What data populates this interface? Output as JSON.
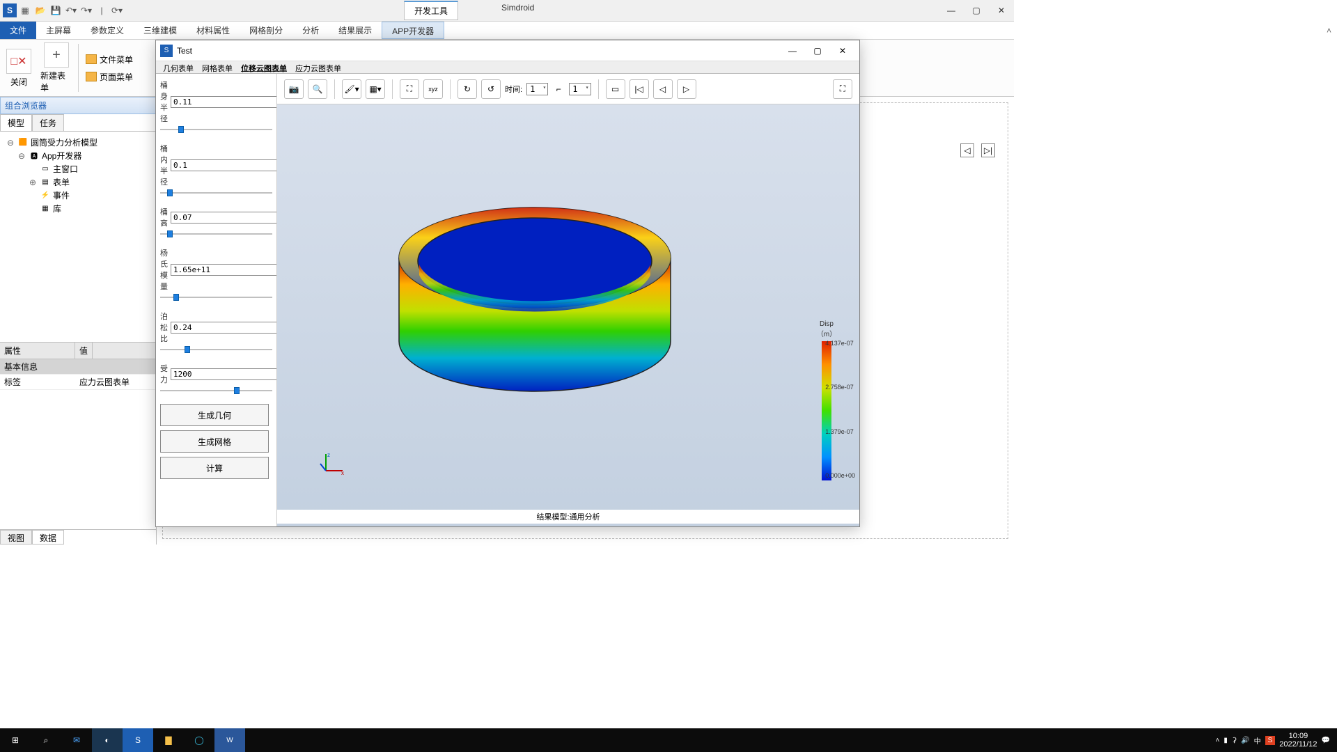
{
  "titlebar": {
    "devtools_tab": "开发工具",
    "app_title": "Simdroid"
  },
  "menu": {
    "items": [
      "文件",
      "主屏幕",
      "参数定义",
      "三维建模",
      "材料属性",
      "网格剖分",
      "分析",
      "结果展示",
      "APP开发器"
    ],
    "active": 0,
    "highlighted": 8
  },
  "ribbon": {
    "close": "关闭",
    "new_form": "新建表单",
    "file_menu": "文件菜单",
    "page_menu": "页面菜单"
  },
  "browser": {
    "title": "组合浏览器",
    "tabs": {
      "model": "模型",
      "task": "任务"
    },
    "tree": [
      {
        "indent": 0,
        "exp": "⊖",
        "ic": "cube",
        "label": "圆筒受力分析模型"
      },
      {
        "indent": 1,
        "exp": "⊖",
        "ic": "app",
        "label": "App开发器"
      },
      {
        "indent": 2,
        "exp": "",
        "ic": "win",
        "label": "主窗口"
      },
      {
        "indent": 2,
        "exp": "⊕",
        "ic": "form",
        "label": "表单"
      },
      {
        "indent": 2,
        "exp": "",
        "ic": "evt",
        "label": "事件"
      },
      {
        "indent": 2,
        "exp": "",
        "ic": "lib",
        "label": "库"
      }
    ]
  },
  "props": {
    "col_prop": "属性",
    "col_val": "值",
    "group": "基本信息",
    "row_label": "标签",
    "row_value": "应力云图表单"
  },
  "bottom_tabs": {
    "view": "视图",
    "data": "数据"
  },
  "dialog": {
    "title": "Test",
    "tabs": [
      "几何表单",
      "网格表单",
      "位移云图表单",
      "应力云图表单"
    ],
    "active_tab": 2,
    "params": [
      {
        "label": "桶身半径",
        "value": "0.11",
        "thumb": 16
      },
      {
        "label": "桶内半径",
        "value": "0.1",
        "thumb": 6
      },
      {
        "label": "桶高",
        "value": "0.07",
        "thumb": 6
      },
      {
        "label": "杨氏模量",
        "value": "1.65e+11",
        "thumb": 12
      },
      {
        "label": "泊松比",
        "value": "0.24",
        "thumb": 22
      },
      {
        "label": "受力",
        "value": "1200",
        "thumb": 66
      }
    ],
    "buttons": [
      "生成几何",
      "生成网格",
      "计算"
    ],
    "time_label": "时间:",
    "time_value": "1",
    "frame_value": "1",
    "legend": {
      "title": "Disp",
      "unit": "（m）",
      "ticks": [
        "4.137e-07",
        "2.758e-07",
        "1.379e-07",
        "0.000e+00"
      ]
    },
    "result_label": "结果模型:通用分析"
  },
  "tray": {
    "ime1": "中",
    "ime2": "S",
    "time": "10:09",
    "date": "2022/11/12"
  }
}
